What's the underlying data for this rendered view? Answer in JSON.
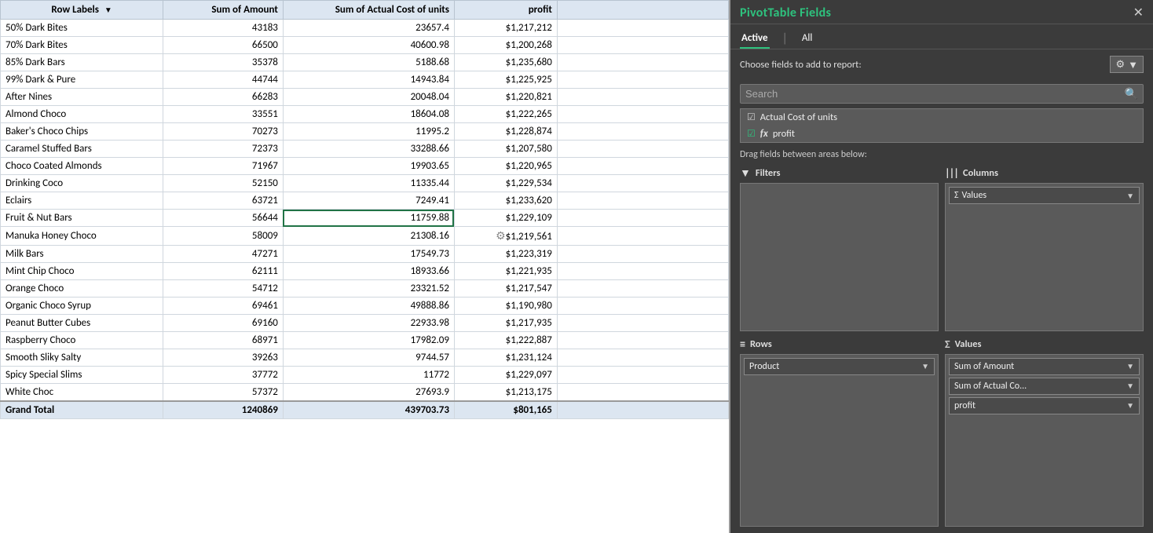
{
  "panel": {
    "title": "PivotTable Fields",
    "close_label": "✕",
    "tabs": [
      {
        "label": "Active",
        "active": true
      },
      {
        "label": "All",
        "active": false
      }
    ],
    "fields_label": "Choose fields to add to report:",
    "search_placeholder": "Search",
    "gear_icon": "⚙",
    "chevron_icon": "▼",
    "fields": [
      {
        "label": "Actual Cost of units",
        "checked": true,
        "is_formula": false
      },
      {
        "label": "profit",
        "checked": true,
        "is_formula": true
      }
    ],
    "drag_note": "Drag fields between areas below:",
    "areas": {
      "filters": {
        "title": "Filters",
        "icon": "▼",
        "items": []
      },
      "columns": {
        "title": "Columns",
        "icon": "|||",
        "chips": [
          {
            "label": "Σ Values",
            "arrow": "▼"
          }
        ]
      },
      "rows": {
        "title": "Rows",
        "icon": "≡",
        "chips": [
          {
            "label": "Product",
            "arrow": "▼"
          }
        ]
      },
      "values": {
        "title": "Values",
        "icon": "Σ",
        "chips": [
          {
            "label": "Sum of Amount",
            "arrow": "▼"
          },
          {
            "label": "Sum of Actual Co...",
            "arrow": "▼"
          },
          {
            "label": "profit",
            "arrow": "▼"
          }
        ]
      }
    }
  },
  "table": {
    "headers": [
      "Row Labels",
      "Sum of Amount",
      "Sum of Actual Cost of units",
      "profit"
    ],
    "filter_icon": "▼",
    "rows": [
      {
        "label": "50% Dark Bites",
        "amount": "43183",
        "actual": "23657.4",
        "profit": "$1,217,212"
      },
      {
        "label": "70% Dark Bites",
        "amount": "66500",
        "actual": "40600.98",
        "profit": "$1,200,268"
      },
      {
        "label": "85% Dark Bars",
        "amount": "35378",
        "actual": "5188.68",
        "profit": "$1,235,680"
      },
      {
        "label": "99% Dark & Pure",
        "amount": "44744",
        "actual": "14943.84",
        "profit": "$1,225,925"
      },
      {
        "label": "After Nines",
        "amount": "66283",
        "actual": "20048.04",
        "profit": "$1,220,821"
      },
      {
        "label": "Almond Choco",
        "amount": "33551",
        "actual": "18604.08",
        "profit": "$1,222,265"
      },
      {
        "label": "Baker's Choco Chips",
        "amount": "70273",
        "actual": "11995.2",
        "profit": "$1,228,874"
      },
      {
        "label": "Caramel Stuffed Bars",
        "amount": "72373",
        "actual": "33288.66",
        "profit": "$1,207,580"
      },
      {
        "label": "Choco Coated Almonds",
        "amount": "71967",
        "actual": "19903.65",
        "profit": "$1,220,965"
      },
      {
        "label": "Drinking Coco",
        "amount": "52150",
        "actual": "11335.44",
        "profit": "$1,229,534"
      },
      {
        "label": "Eclairs",
        "amount": "63721",
        "actual": "7249.41",
        "profit": "$1,233,620"
      },
      {
        "label": "Fruit & Nut Bars",
        "amount": "56644",
        "actual": "11759.88",
        "profit": "$1,229,109",
        "selected": true
      },
      {
        "label": "Manuka Honey Choco",
        "amount": "58009",
        "actual": "21308.16",
        "profit": "$1,219,561",
        "context": true
      },
      {
        "label": "Milk Bars",
        "amount": "47271",
        "actual": "17549.73",
        "profit": "$1,223,319"
      },
      {
        "label": "Mint Chip Choco",
        "amount": "62111",
        "actual": "18933.66",
        "profit": "$1,221,935"
      },
      {
        "label": "Orange Choco",
        "amount": "54712",
        "actual": "23321.52",
        "profit": "$1,217,547"
      },
      {
        "label": "Organic Choco Syrup",
        "amount": "69461",
        "actual": "49888.86",
        "profit": "$1,190,980"
      },
      {
        "label": "Peanut Butter Cubes",
        "amount": "69160",
        "actual": "22933.98",
        "profit": "$1,217,935"
      },
      {
        "label": "Raspberry Choco",
        "amount": "68971",
        "actual": "17982.09",
        "profit": "$1,222,887"
      },
      {
        "label": "Smooth Sliky Salty",
        "amount": "39263",
        "actual": "9744.57",
        "profit": "$1,231,124"
      },
      {
        "label": "Spicy Special Slims",
        "amount": "37772",
        "actual": "11772",
        "profit": "$1,229,097"
      },
      {
        "label": "White Choc",
        "amount": "57372",
        "actual": "27693.9",
        "profit": "$1,213,175"
      }
    ],
    "grand_total": {
      "label": "Grand Total",
      "amount": "1240869",
      "actual": "439703.73",
      "profit": "$801,165"
    }
  }
}
